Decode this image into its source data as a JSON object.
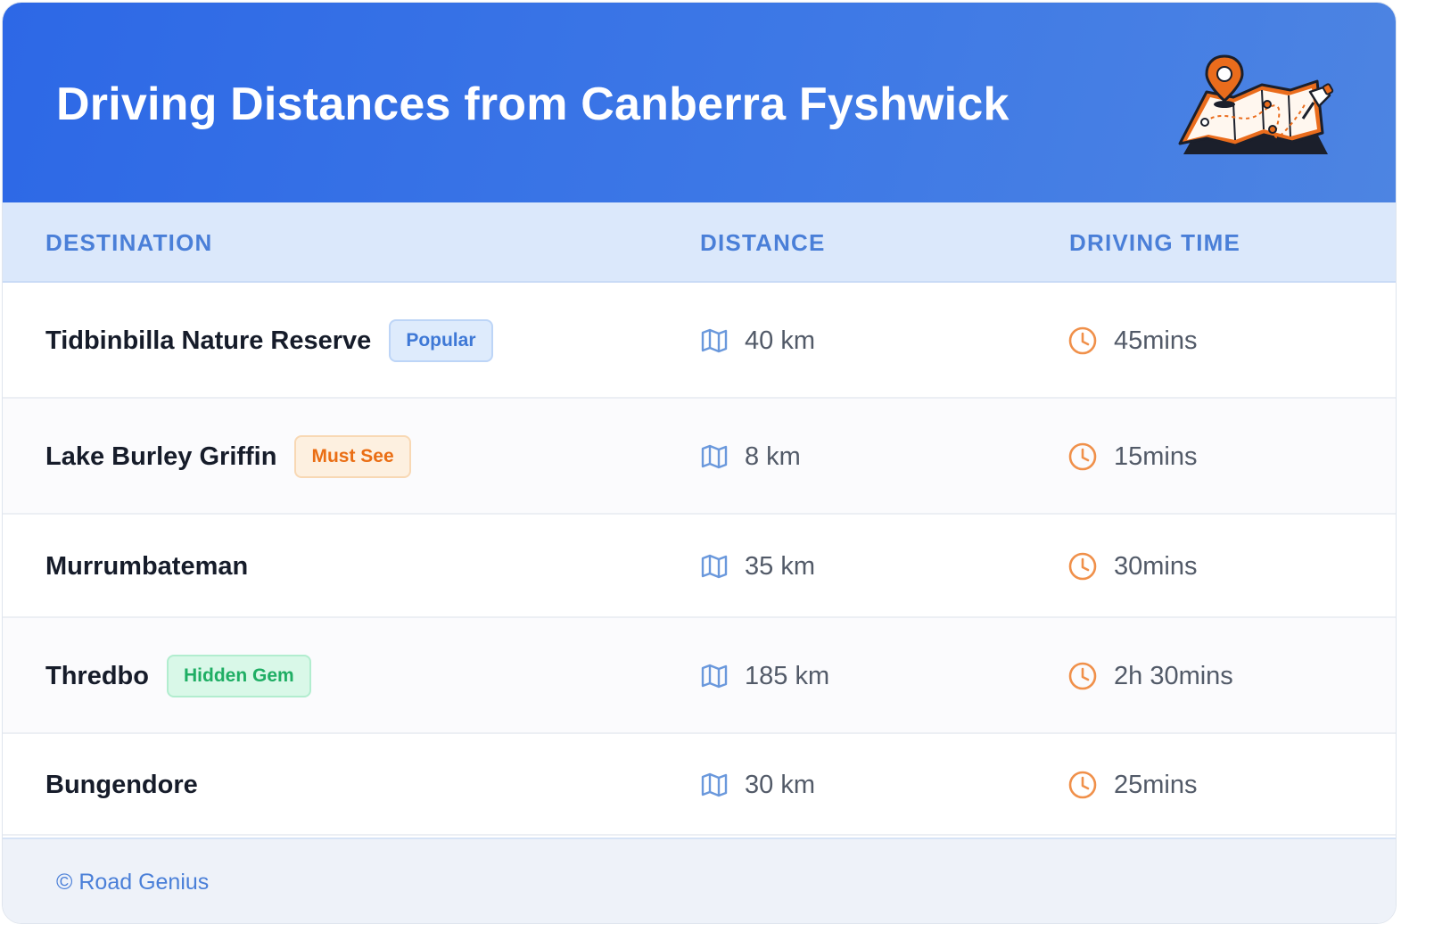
{
  "header": {
    "title": "Driving Distances from Canberra Fyshwick",
    "illustration_icon": "map-with-pins-icon"
  },
  "table": {
    "columns": [
      "DESTINATION",
      "DISTANCE",
      "DRIVING TIME"
    ],
    "rows": [
      {
        "destination": "Tidbinbilla Nature Reserve",
        "badge": "Popular",
        "badge_color": "#3e78d6",
        "distance": "40 km",
        "time": "45mins"
      },
      {
        "destination": "Lake Burley Griffin",
        "badge": "Must See",
        "badge_color": "#ea6e14",
        "distance": "8 km",
        "time": "15mins"
      },
      {
        "destination": "Murrumbateman",
        "badge": "",
        "distance": "35 km",
        "time": "30mins"
      },
      {
        "destination": "Thredbo",
        "badge": "Hidden Gem",
        "badge_color": "#1fae64",
        "distance": "185 km",
        "time": "2h 30mins"
      },
      {
        "destination": "Bungendore",
        "badge": "",
        "distance": "30 km",
        "time": "25mins"
      }
    ],
    "distance_icon": "map-icon",
    "time_icon": "clock-icon"
  },
  "footer": {
    "text": "© Road Genius"
  },
  "colors": {
    "header_gradient_start": "#2d68e6",
    "header_gradient_end": "#4d84e2",
    "accent_blue": "#4a7fd8",
    "clock_orange": "#f0904a"
  }
}
